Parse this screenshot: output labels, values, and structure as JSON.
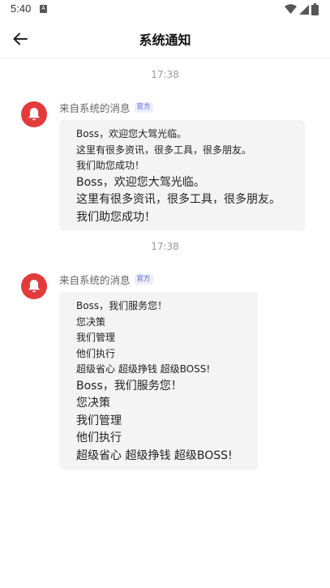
{
  "status_bar": {
    "time": "5:40",
    "app_icon_letter": "A",
    "icons": [
      "notification-app-icon",
      "wifi-icon",
      "signal-icon",
      "battery-icon"
    ]
  },
  "header": {
    "title": "系统通知",
    "back_icon": "arrow-left-icon"
  },
  "messages": [
    {
      "timestamp": "17:38",
      "sender": "来自系统的消息",
      "badge": "官方",
      "avatar_icon": "bell-icon",
      "lines_small": [
        "Boss，欢迎您大驾光临。",
        "这里有很多资讯，很多工具，很多朋友。",
        "我们助您成功！"
      ],
      "lines_large": [
        "Boss，欢迎您大驾光临。",
        "这里有很多资讯，很多工具，很多朋友。",
        "我们助您成功！"
      ]
    },
    {
      "timestamp": "17:38",
      "sender": "来自系统的消息",
      "badge": "官方",
      "avatar_icon": "bell-icon",
      "lines_small": [
        "Boss，我们服务您！",
        "您决策",
        "我们管理",
        "他们执行",
        "超级省心 超级挣钱 超级BOSS!"
      ],
      "lines_large": [
        "Boss，我们服务您！",
        "您决策",
        "我们管理",
        "他们执行",
        "超级省心 超级挣钱 超级BOSS!"
      ]
    }
  ],
  "colors": {
    "avatar_red": "#e33b3b",
    "bubble_bg": "#f4f4f4",
    "badge_text": "#5b6bd9",
    "badge_bg": "#eceefc",
    "timestamp_gray": "#9a9a9a"
  }
}
